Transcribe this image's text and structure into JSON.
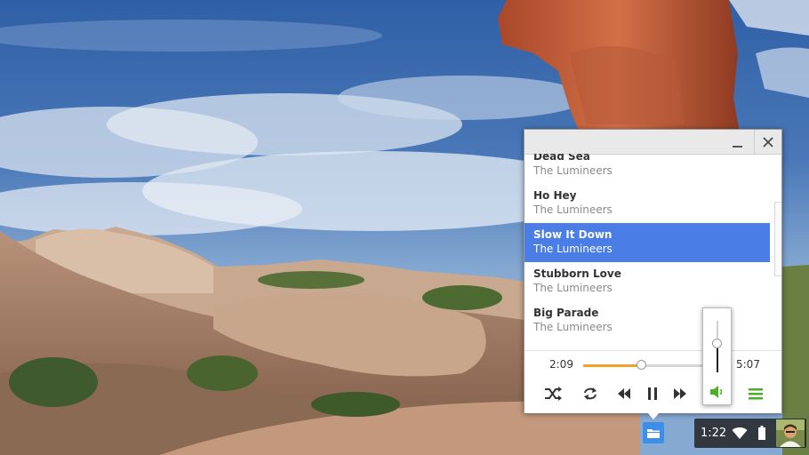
{
  "player": {
    "playlist": [
      {
        "title": "Dead Sea",
        "artist": "The Lumineers",
        "active": false
      },
      {
        "title": "Ho Hey",
        "artist": "The Lumineers",
        "active": false
      },
      {
        "title": "Slow It Down",
        "artist": "The Lumineers",
        "active": true
      },
      {
        "title": "Stubborn Love",
        "artist": "The Lumineers",
        "active": false
      },
      {
        "title": "Big Parade",
        "artist": "The Lumineers",
        "active": false
      }
    ],
    "current_time": "2:09",
    "duration": "5:07",
    "progress": 0.42,
    "volume": 0.55,
    "colors": {
      "accent": "#4a7ee6",
      "seek": "#f0a030",
      "speaker": "#4caf2a",
      "menu": "#4caf2a"
    }
  },
  "icons": {
    "minimize": "minimize-icon",
    "close": "close-icon",
    "shuffle": "shuffle-icon",
    "repeat": "repeat-icon",
    "previous": "previous-icon",
    "pause": "pause-icon",
    "next": "next-icon",
    "volume": "volume-icon",
    "playlist": "playlist-icon",
    "files": "folder-icon",
    "wifi": "wifi-icon",
    "battery": "battery-icon"
  },
  "tray": {
    "clock": "1:22"
  }
}
